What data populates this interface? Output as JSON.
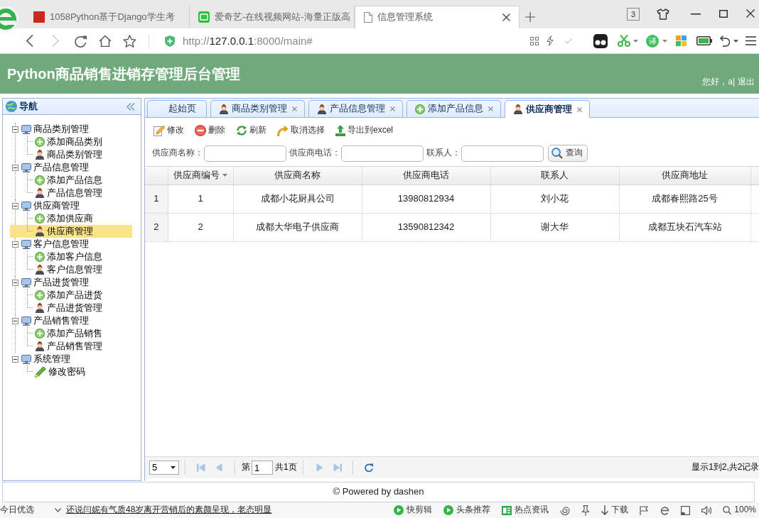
{
  "browser": {
    "tabs": [
      {
        "title": "1058Python基于Django学生考",
        "kind": "page",
        "selected": false
      },
      {
        "title": "爱奇艺-在线视频网站-海量正版高",
        "kind": "video",
        "selected": false
      },
      {
        "title": "信息管理系统",
        "kind": "document",
        "selected": true
      }
    ],
    "window_count": "3",
    "forward_disabled": true,
    "address": {
      "scheme": "http://",
      "host": "127.0.0.1",
      "path": ":8000/main#"
    },
    "translate": "译"
  },
  "header": {
    "title": "Python商品销售进销存管理后台管理",
    "greeting": "您好，a|",
    "logout": "退出"
  },
  "sidebar": {
    "title": "导航",
    "tree": [
      {
        "label": "商品类别管理",
        "expanded": true,
        "selected": false,
        "children": [
          {
            "label": "添加商品类别",
            "kind": "add",
            "selected": false
          },
          {
            "label": "商品类别管理",
            "kind": "manage",
            "selected": false
          }
        ]
      },
      {
        "label": "产品信息管理",
        "expanded": true,
        "selected": false,
        "children": [
          {
            "label": "添加产品信息",
            "kind": "add",
            "selected": false
          },
          {
            "label": "产品信息管理",
            "kind": "manage",
            "selected": false
          }
        ]
      },
      {
        "label": "供应商管理",
        "expanded": true,
        "selected": false,
        "children": [
          {
            "label": "添加供应商",
            "kind": "add",
            "selected": false
          },
          {
            "label": "供应商管理",
            "kind": "manage",
            "selected": true
          }
        ]
      },
      {
        "label": "客户信息管理",
        "expanded": true,
        "selected": false,
        "children": [
          {
            "label": "添加客户信息",
            "kind": "add",
            "selected": false
          },
          {
            "label": "客户信息管理",
            "kind": "manage",
            "selected": false
          }
        ]
      },
      {
        "label": "产品进货管理",
        "expanded": true,
        "selected": false,
        "children": [
          {
            "label": "添加产品进货",
            "kind": "add",
            "selected": false
          },
          {
            "label": "产品进货管理",
            "kind": "manage",
            "selected": false
          }
        ]
      },
      {
        "label": "产品销售管理",
        "expanded": true,
        "selected": false,
        "children": [
          {
            "label": "添加产品销售",
            "kind": "add",
            "selected": false
          },
          {
            "label": "产品销售管理",
            "kind": "manage",
            "selected": false
          }
        ]
      },
      {
        "label": "系统管理",
        "expanded": true,
        "selected": false,
        "children": [
          {
            "label": "修改密码",
            "kind": "password",
            "selected": false
          }
        ]
      }
    ]
  },
  "tabs": [
    {
      "label": "起始页",
      "kind": "home",
      "closable": false,
      "selected": false
    },
    {
      "label": "商品类别管理",
      "kind": "manage",
      "closable": true,
      "selected": false
    },
    {
      "label": "产品信息管理",
      "kind": "manage",
      "closable": true,
      "selected": false
    },
    {
      "label": "添加产品信息",
      "kind": "add",
      "closable": true,
      "selected": false
    },
    {
      "label": "供应商管理",
      "kind": "manage",
      "closable": true,
      "selected": true
    }
  ],
  "toolbar": [
    {
      "label": "修改",
      "kind": "edit"
    },
    {
      "label": "删除",
      "kind": "delete"
    },
    {
      "label": "刷新",
      "kind": "refresh"
    },
    {
      "label": "取消选择",
      "kind": "undo"
    },
    {
      "label": "导出到excel",
      "kind": "export"
    }
  ],
  "search": {
    "fields": [
      {
        "label": "供应商名称："
      },
      {
        "label": "供应商电话："
      },
      {
        "label": "联系人："
      }
    ],
    "button": "查询"
  },
  "table": {
    "columns": [
      {
        "label": "供应商编号",
        "sorted": true
      },
      {
        "label": "供应商名称",
        "sorted": false
      },
      {
        "label": "供应商电话",
        "sorted": false
      },
      {
        "label": "联系人",
        "sorted": false
      },
      {
        "label": "供应商地址",
        "sorted": false
      }
    ],
    "rows": [
      {
        "number": "1",
        "selected": false,
        "cells": [
          "1",
          "成都小花厨具公司",
          "13980812934",
          "刘小花",
          "成都春熙路25号"
        ]
      },
      {
        "number": "2",
        "selected": false,
        "cells": [
          "2",
          "成都大华电子供应商",
          "13590812342",
          "谢大华",
          "成都五块石汽车站"
        ]
      }
    ]
  },
  "pager": {
    "page_size": "5",
    "page_prefix": "第",
    "page": "1",
    "page_suffix": "共1页",
    "buttons": [
      {
        "kind": "first",
        "disabled": true
      },
      {
        "kind": "prev",
        "disabled": true
      },
      {
        "kind": "next",
        "disabled": true
      },
      {
        "kind": "last",
        "disabled": true
      },
      {
        "kind": "refresh",
        "disabled": false
      }
    ],
    "summary": "显示1到2,共2记录"
  },
  "footer": "© Powered by dashen",
  "status_bar": {
    "left": "今日优选",
    "headline": "还说闫妮有气质48岁离开营销后的素颜呈现，老态明显",
    "items": [
      {
        "label": "快剪辑",
        "kind": "play"
      },
      {
        "label": "头条推荐",
        "kind": "play"
      },
      {
        "label": "热点资讯",
        "kind": "news"
      },
      {
        "label": "下载",
        "kind": "download"
      }
    ],
    "zoom": "100%"
  }
}
